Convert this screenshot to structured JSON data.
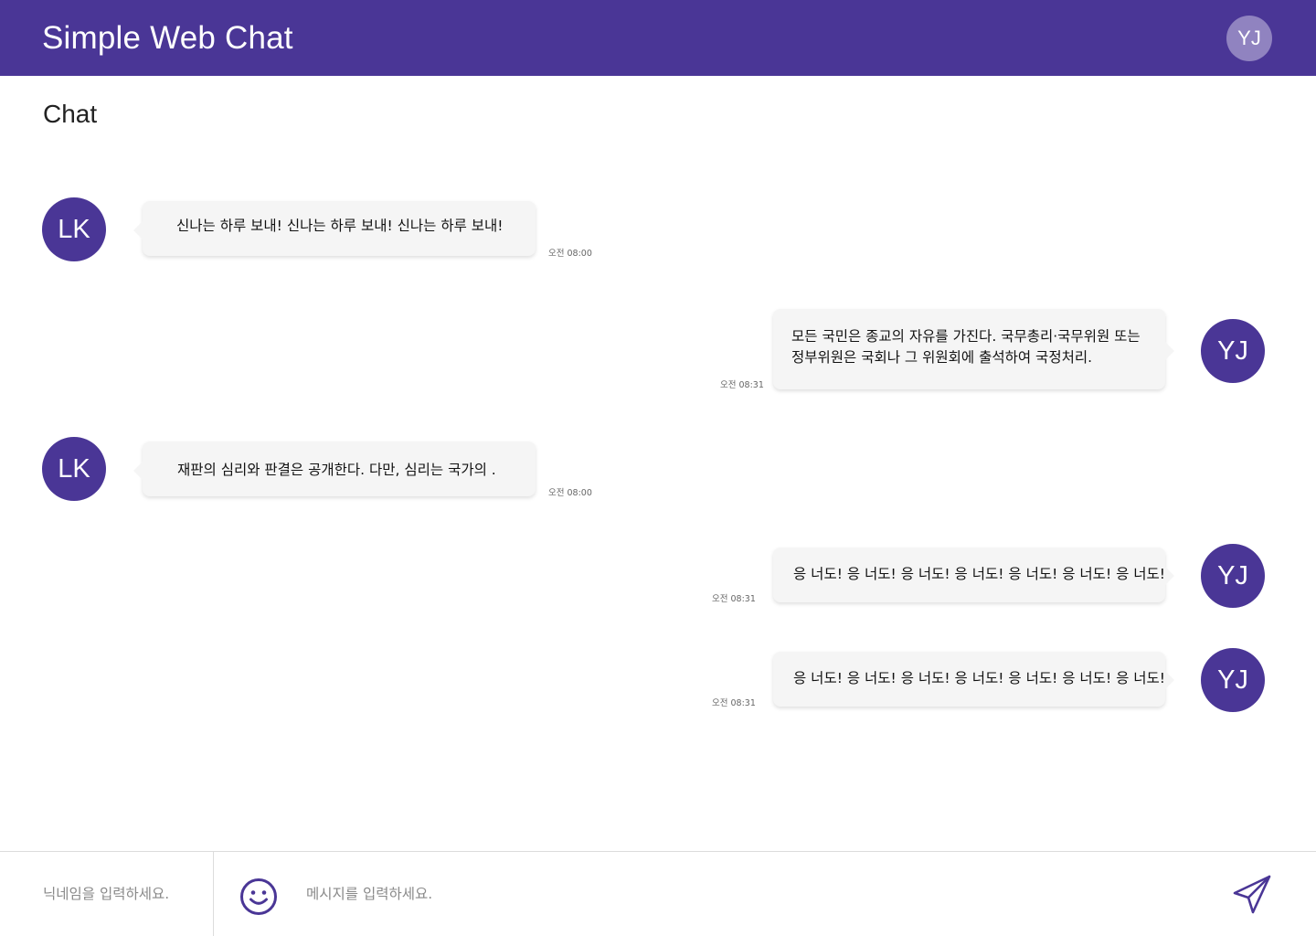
{
  "header": {
    "title": "Simple Web Chat",
    "user_initials": "YJ"
  },
  "section_title": "Chat",
  "colors": {
    "brand": "#4a3696",
    "header_avatar": "#9083c0",
    "bubble": "#f5f5f5"
  },
  "messages": [
    {
      "side": "left",
      "initials": "LK",
      "lines": [
        "신나는 하루 보내! 신나는 하루 보내! 신나는 하루 보내!"
      ],
      "time": "오전 08:00"
    },
    {
      "side": "right",
      "initials": "YJ",
      "lines": [
        "모든 국민은 종교의 자유를 가진다. 국무총리·국무위원 또는",
        "정부위원은 국회나 그 위원회에 출석하여 국정처리."
      ],
      "time": "오전 08:31"
    },
    {
      "side": "left",
      "initials": "LK",
      "lines": [
        "재판의 심리와 판결은 공개한다. 다만, 심리는 국가의 ."
      ],
      "time": "오전 08:00"
    },
    {
      "side": "right",
      "initials": "YJ",
      "lines": [
        "응 너도! 응 너도! 응 너도! 응 너도! 응 너도! 응 너도! 응 너도!"
      ],
      "time": "오전 08:31"
    },
    {
      "side": "right",
      "initials": "YJ",
      "lines": [
        "응 너도! 응 너도! 응 너도! 응 너도! 응 너도! 응 너도! 응 너도!"
      ],
      "time": "오전 08:31"
    }
  ],
  "footer": {
    "nickname_placeholder": "닉네임을 입력하세요.",
    "message_placeholder": "메시지를 입력하세요.",
    "emoji_icon": "smiley-icon",
    "send_icon": "paper-plane-icon"
  }
}
